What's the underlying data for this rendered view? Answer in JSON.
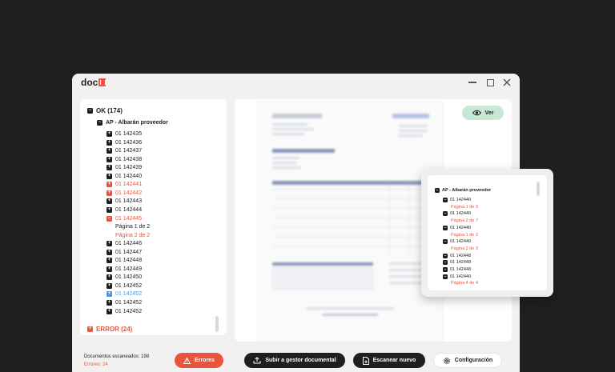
{
  "app": {
    "logo_text": "doc"
  },
  "tree": {
    "ok_group": "OK (174)",
    "subgroup": "AP - Albarán proveedor",
    "items": [
      {
        "id": "01 142435",
        "status": "ok",
        "expanded": false
      },
      {
        "id": "01 142436",
        "status": "ok",
        "expanded": false
      },
      {
        "id": "01 142437",
        "status": "ok",
        "expanded": false
      },
      {
        "id": "01 142438",
        "status": "ok",
        "expanded": false
      },
      {
        "id": "01 142439",
        "status": "ok",
        "expanded": false
      },
      {
        "id": "01 142440",
        "status": "ok",
        "expanded": false
      },
      {
        "id": "01 142441",
        "status": "error",
        "expanded": false
      },
      {
        "id": "01 142442",
        "status": "error",
        "expanded": false
      },
      {
        "id": "01 142443",
        "status": "ok",
        "expanded": false
      },
      {
        "id": "01 142444",
        "status": "ok",
        "expanded": false
      },
      {
        "id": "01 142445",
        "status": "error",
        "expanded": true,
        "children": [
          {
            "label": "Página 1 de 2",
            "status": "ok"
          },
          {
            "label": "Página 2 de 2",
            "status": "error"
          }
        ]
      },
      {
        "id": "01 142446",
        "status": "ok",
        "expanded": false
      },
      {
        "id": "01 142447",
        "status": "ok",
        "expanded": false
      },
      {
        "id": "01 142448",
        "status": "ok",
        "expanded": false
      },
      {
        "id": "01 142449",
        "status": "ok",
        "expanded": false
      },
      {
        "id": "01 142450",
        "status": "ok",
        "expanded": false
      },
      {
        "id": "01 142452",
        "status": "ok",
        "expanded": false
      },
      {
        "id": "01 142452",
        "status": "selected",
        "expanded": false
      },
      {
        "id": "01 142452",
        "status": "ok",
        "expanded": false
      },
      {
        "id": "01 142452",
        "status": "ok",
        "expanded": false
      }
    ],
    "error_group": "ERROR (24)"
  },
  "preview": {
    "view_label": "Ver"
  },
  "status": {
    "docs_scanned": "Documentos escaneados: 198",
    "errors": "Errores: 24"
  },
  "actions": {
    "errors_label": "Errores",
    "upload_label": "Subir a gestor documental",
    "scan_label": "Escanear nuevo",
    "config_label": "Configuración"
  },
  "popup": {
    "title": "AP - Albarán proveedor",
    "items": [
      {
        "id": "01 142440",
        "page": "Página 1 de 3"
      },
      {
        "id": "01 142440",
        "page": "Página 2 de 7"
      },
      {
        "id": "01 142440",
        "page": "Página 1 de 2"
      },
      {
        "id": "01 142440",
        "page": "Página 2 de 3"
      },
      {
        "id": "01 142448",
        "page": null
      },
      {
        "id": "01 142448",
        "page": null
      },
      {
        "id": "01 142448",
        "page": null
      },
      {
        "id": "01 142440",
        "page": "Página 4 de 4"
      }
    ]
  },
  "colors": {
    "accent_red": "#e8553e",
    "selected_blue": "#4a9be0",
    "view_green": "#c8e8d6",
    "dark": "#1f1f1f"
  }
}
